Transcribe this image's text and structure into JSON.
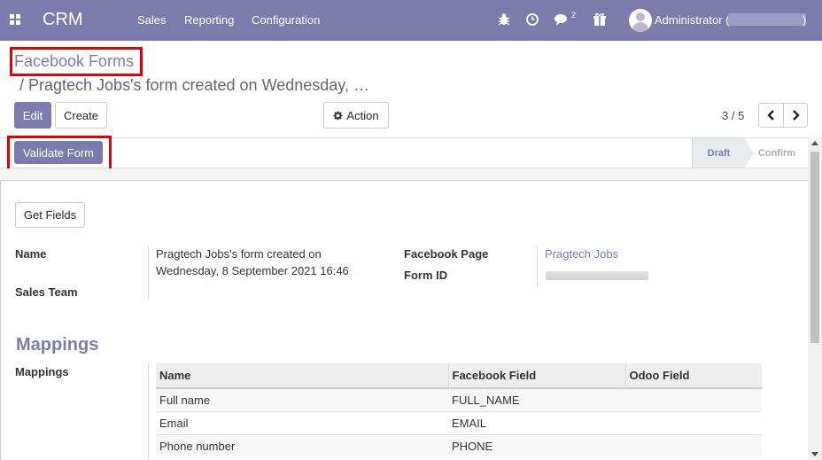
{
  "navbar": {
    "brand": "CRM",
    "menu": [
      "Sales",
      "Reporting",
      "Configuration"
    ],
    "icons": [
      "apps-icon",
      "bug-icon",
      "clock-icon",
      "chat-icon",
      "gift-icon"
    ],
    "chat_count": "2",
    "user": "Administrator (",
    "user_close": ")"
  },
  "breadcrumb": {
    "parent": "Facebook Forms",
    "current": "/ Pragtech Jobs's form created on Wednesday, …"
  },
  "toolbar": {
    "edit": "Edit",
    "create": "Create",
    "action": "Action",
    "pager": "3 / 5"
  },
  "header": {
    "validate": "Validate Form",
    "states": [
      "Draft",
      "Confirm"
    ]
  },
  "form": {
    "get_fields": "Get Fields",
    "name_label": "Name",
    "name_value_line1": "Pragtech Jobs's form created on",
    "name_value_line2": "Wednesday, 8 September 2021 16:46",
    "sales_team_label": "Sales Team",
    "fb_page_label": "Facebook Page",
    "fb_page_value": "Pragtech Jobs",
    "form_id_label": "Form ID"
  },
  "mappings": {
    "section_title": "Mappings",
    "field_label": "Mappings",
    "columns": [
      "Name",
      "Facebook Field",
      "Odoo Field"
    ],
    "rows": [
      [
        "Full name",
        "FULL_NAME",
        ""
      ],
      [
        "Email",
        "EMAIL",
        ""
      ],
      [
        "Phone number",
        "PHONE",
        ""
      ]
    ]
  },
  "colors": {
    "brand": "#7c7bad",
    "highlight": "#e50000"
  }
}
